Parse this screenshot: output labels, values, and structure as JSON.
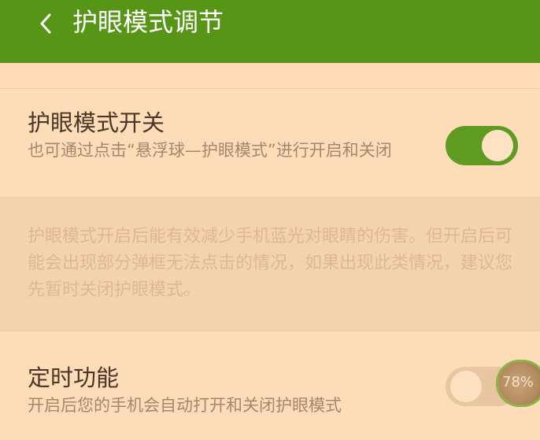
{
  "header": {
    "title": "护眼模式调节"
  },
  "eye_mode": {
    "title": "护眼模式开关",
    "desc": "也可通过点击“悬浮球—护眼模式”进行开启和关闭",
    "toggle_state": "on"
  },
  "note": {
    "text": "护眼模式开启后能有效减少手机蓝光对眼睛的伤害。但开启后可能会出现部分弹框无法点击的情况，如果出现此类情况，建议您先暂时关闭护眼模式。"
  },
  "timer": {
    "title": "定时功能",
    "desc": "开启后您的手机会自动打开和关闭护眼模式",
    "toggle_state": "off"
  },
  "float_ball": {
    "label": "78%"
  },
  "colors": {
    "header_bg": "#579517",
    "page_bg": "#fddcb8",
    "toggle_on": "#5e9b20"
  },
  "icons": {
    "back": "chevron-left-icon"
  }
}
